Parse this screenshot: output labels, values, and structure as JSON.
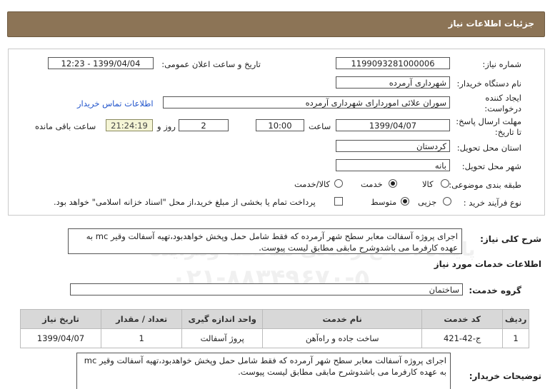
{
  "header": {
    "title": "جزئیات اطلاعات نیاز"
  },
  "form": {
    "need_number_label": "شماره نیاز:",
    "need_number": "1199093281000006",
    "announce_label": "تاریخ و ساعت اعلان عمومی:",
    "announce_value": "1399/04/04 - 12:23",
    "buyer_org_label": "نام دستگاه خریدار:",
    "buyer_org": "شهرداری آرمرده",
    "creator_label_1": "ایجاد کننده",
    "creator_label_2": "درخواست:",
    "creator": "سوران علائی اموردارای شهرداری آرمرده",
    "contact_link": "اطلاعات تماس خریدار",
    "deadline_label_1": "مهلت ارسال پاسخ:",
    "deadline_label_2": "تا تاریخ:",
    "deadline_date": "1399/04/07",
    "time_label": "ساعت",
    "deadline_time": "10:00",
    "days_value": "2",
    "days_label": "روز و",
    "remaining_time": "21:24:19",
    "remaining_label": "ساعت باقی مانده",
    "province_label": "استان محل تحویل:",
    "province": "کردستان",
    "city_label": "شهر محل تحویل:",
    "city": "بانه",
    "category_label": "طبقه بندی موضوعی:",
    "category_options": [
      "کالا",
      "خدمت",
      "کالا/خدمت"
    ],
    "purchase_type_label": "نوع فرآیند خرید :",
    "purchase_options": [
      "جزیی",
      "متوسط"
    ],
    "payment_note": "پرداخت تمام یا بخشی از مبلغ خرید،از محل \"اسناد خزانه اسلامی\" خواهد بود."
  },
  "summary": {
    "label": "شرح کلی نیاز:",
    "text": "اجرای پروژه آسفالت معابر سطح شهر آرمرده که فقط شامل حمل وپخش خواهدبود،تهیه آسفالت وقیر mc به عهده کارفرما می باشدوشرح مابقی مطابق لیست پیوست."
  },
  "services": {
    "title": "اطلاعات خدمات مورد نیاز",
    "group_label": "گروه خدمت:",
    "group_value": "ساختمان",
    "columns": [
      "ردیف",
      "کد خدمت",
      "نام خدمت",
      "واحد اندازه گیری",
      "تعداد / مقدار",
      "تاریخ نیاز"
    ],
    "rows": [
      [
        "1",
        "ج-42-421",
        "ساخت جاده و راه‌آهن",
        "پروژ آسفالت",
        "1",
        "1399/04/07"
      ]
    ]
  },
  "buyer_notes": {
    "label": "توضیحات خریدار:",
    "text": "اجرای پروژه آسفالت معابر سطح شهر آرمرده که فقط شامل حمل وپخش خواهدبود،تهیه آسفالت وقیر mc به عهده کارفرما می باشدوشرح مابقی مطابق لیست پیوست."
  },
  "watermark": {
    "brand": "ParsNamadData",
    "line1": "پایگاه اطلاع رسانی مناقصه ومزایده",
    "phone": "۰۲۱-۸۸۳۴۹۶۷۰-۵"
  },
  "colors": {
    "header": "#8c7456",
    "link": "#2255cc",
    "remaining_bg": "#f5f5d5",
    "table_header": "#d8d8d8"
  }
}
